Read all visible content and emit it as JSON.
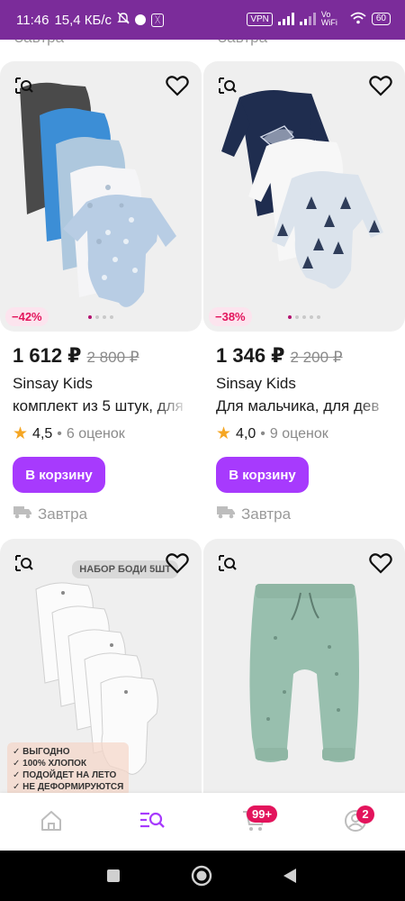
{
  "status_bar": {
    "time": "11:46",
    "speed": "15,4 КБ/с",
    "vpn": "VPN",
    "network": "Vo WiFi",
    "battery": "60"
  },
  "peek_row": {
    "left": "Завтра",
    "right": "Завтра"
  },
  "products": [
    {
      "price": "1 612 ₽",
      "old_price": "2 800 ₽",
      "discount": "−42%",
      "brand": "Sinsay Kids",
      "title": "комплект из 5 штук, для",
      "rating": "4,5",
      "reviews": "6 оценок",
      "cart_label": "В корзину",
      "delivery": "Завтра"
    },
    {
      "price": "1 346 ₽",
      "old_price": "2 200 ₽",
      "discount": "−38%",
      "brand": "Sinsay Kids",
      "title": "Для мальчика, для дев",
      "rating": "4,0",
      "reviews": "9 оценок",
      "cart_label": "В корзину",
      "delivery": "Завтра"
    },
    {
      "badge": "НАБОР БОДИ 5ШТ",
      "features": [
        "✓ ВЫГОДНО",
        "✓ 100% ХЛОПОК",
        "✓ ПОДОЙДЕТ НА ЛЕТО",
        "✓ НЕ ДЕФОРМИРУЮТСЯ"
      ]
    },
    {}
  ],
  "bottom_nav": {
    "cart_badge": "99+",
    "profile_badge": "2",
    "accent": "#a73afd"
  },
  "colors": {
    "status_bar": "#7b2c9a",
    "button": "#a73afd",
    "discount_text": "#e3145c",
    "star": "#f5a623"
  }
}
